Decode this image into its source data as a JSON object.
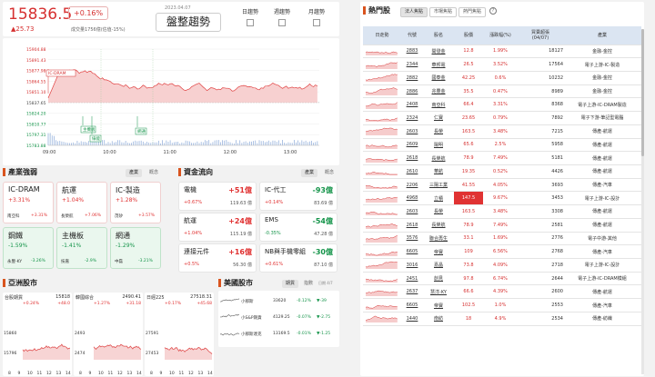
{
  "quote": {
    "price": "15836.5",
    "change_pct": "+0.16%",
    "change": "▲25.73",
    "volume": "成交量1756億(估值-15%)",
    "date": "2023.04.07",
    "trend": "盤整趨勢",
    "checks": [
      "日趨勢",
      "週趨勢",
      "月趨勢"
    ]
  },
  "intraday": {
    "yticks": [
      "15904.88",
      "15891.43",
      "15877.98",
      "15864.55",
      "15851.10",
      "15837.65",
      "15824.20",
      "15810.77",
      "15797.31",
      "15783.88"
    ],
    "xticks": [
      "09:00",
      "10:00",
      "11:00",
      "12:00",
      "13:00"
    ],
    "annotations": [
      "IC-DRAM",
      "主機板",
      "綠能",
      "網通"
    ]
  },
  "industry": {
    "title": "產業強弱",
    "tabs": [
      "產業",
      "概念"
    ],
    "items": [
      {
        "name": "IC-DRAM",
        "pct": "+3.31%",
        "sub": "南亞科",
        "subpct": "+3.31%"
      },
      {
        "name": "航運",
        "pct": "+1.04%",
        "sub": "長榮航",
        "subpct": "+7.06%"
      },
      {
        "name": "IC-製造",
        "pct": "+1.28%",
        "sub": "茂矽",
        "subpct": "+3.57%"
      },
      {
        "name": "鋼鐵",
        "pct": "-1.59%",
        "sub": "永豐-KY",
        "subpct": "-3.26%"
      },
      {
        "name": "主機板",
        "pct": "-1.41%",
        "sub": "技嘉",
        "subpct": "-2.9%"
      },
      {
        "name": "網通",
        "pct": "-1.29%",
        "sub": "中磊",
        "subpct": "-3.21%"
      }
    ]
  },
  "fund": {
    "title": "資金流向",
    "tabs": [
      "產業",
      "概念"
    ],
    "items": [
      {
        "name": "電機",
        "amt": "+51億",
        "pct": "+0.67%",
        "val": "119.63 億"
      },
      {
        "name": "IC-代工",
        "amt": "-93億",
        "pct": "+0.14%",
        "val": "83.69 億"
      },
      {
        "name": "航運",
        "amt": "+24億",
        "pct": "+1.04%",
        "val": "115.19 億"
      },
      {
        "name": "EMS",
        "amt": "-54億",
        "pct": "-0.35%",
        "val": "47.28 億"
      },
      {
        "name": "連接元件",
        "amt": "+16億",
        "pct": "+0.5%",
        "val": "56.30 億"
      },
      {
        "name": "NB與手機零組",
        "amt": "-30億",
        "pct": "+0.61%",
        "val": "87.10 億"
      }
    ]
  },
  "asia": {
    "title": "亞洲股市",
    "markets": [
      {
        "name": "台股期貨",
        "price": "15818",
        "chg": "+0.24%",
        "chg2": "+48.0",
        "low": "15796",
        "high": "15860",
        "xt": [
          "8",
          "9",
          "10",
          "11",
          "12",
          "13",
          "14"
        ]
      },
      {
        "name": "韓國綜合",
        "price": "2490.41",
        "chg": "+1.27%",
        "chg2": "+31.18",
        "low": "2474",
        "high": "2493",
        "xt": [
          "8",
          "9",
          "10",
          "11",
          "12",
          "13",
          "14"
        ]
      },
      {
        "name": "日經225",
        "price": "27518.31",
        "chg": "+0.17%",
        "chg2": "+45.68",
        "low": "27453",
        "high": "27591",
        "xt": [
          "8",
          "9",
          "10",
          "11",
          "12",
          "13",
          "14"
        ]
      }
    ]
  },
  "us": {
    "title": "美國股市",
    "tabs": [
      "期貨",
      "指數"
    ],
    "date": "日期 4/7",
    "items": [
      {
        "name": "小那斯",
        "price": "33620",
        "pct": "-0.12%",
        "chg": "▼-39"
      },
      {
        "name": "小S&P期貨",
        "price": "4129.25",
        "pct": "-0.07%",
        "chg": "▼-2.75"
      },
      {
        "name": "小那斯達克",
        "price": "13169.5",
        "pct": "-0.01%",
        "chg": "▼-1.25"
      }
    ]
  },
  "hot": {
    "title": "熱門股",
    "tabs": [
      "法人焦點",
      "市場焦點",
      "熱門焦點"
    ],
    "headers": [
      "日走勢",
      "代號",
      "股名",
      "股價",
      "漲跌幅(%)",
      "買賣超張\n(04/07)",
      "產業"
    ],
    "rows": [
      [
        "2883",
        "開發金",
        "12.8",
        "1.99%",
        "18127",
        "金融-金控"
      ],
      [
        "2344",
        "華邦電",
        "26.5",
        "3.52%",
        "17564",
        "電子上游-IC-製造"
      ],
      [
        "2882",
        "國泰金",
        "42.25",
        "0.6%",
        "10232",
        "金融-金控"
      ],
      [
        "2886",
        "兆豐金",
        "35.5",
        "0.47%",
        "8989",
        "金融-金控"
      ],
      [
        "2408",
        "南亞科",
        "66.4",
        "3.31%",
        "8368",
        "電子上游-IC-DRAM製造"
      ],
      [
        "2324",
        "仁寶",
        "23.65",
        "0.79%",
        "7892",
        "電子下游-筆記型電腦"
      ],
      [
        "2603",
        "長榮",
        "163.5",
        "3.48%",
        "7215",
        "傳產-航運"
      ],
      [
        "2609",
        "陽明",
        "65.6",
        "2.5%",
        "5958",
        "傳產-航運"
      ],
      [
        "2618",
        "長榮航",
        "78.9",
        "7.49%",
        "5181",
        "傳產-航運"
      ],
      [
        "2610",
        "華航",
        "19.35",
        "0.52%",
        "4426",
        "傳產-航運"
      ],
      [
        "2206",
        "三陽工業",
        "41.55",
        "4.05%",
        "3693",
        "傳產-汽車"
      ],
      [
        "4968",
        "立積",
        "147.5",
        "9.67%",
        "3453",
        "電子上游-IC-設計"
      ],
      [
        "2603",
        "長榮",
        "163.5",
        "3.48%",
        "3308",
        "傳產-航運"
      ],
      [
        "2618",
        "長榮航",
        "78.9",
        "7.49%",
        "2581",
        "傳產-航運"
      ],
      [
        "3576",
        "聯合再生",
        "33.1",
        "1.69%",
        "2776",
        "電子中游-其他"
      ],
      [
        "6605",
        "帝寶",
        "109",
        "6.56%",
        "2768",
        "傳產-汽車"
      ],
      [
        "3016",
        "嘉晶",
        "73.8",
        "4.09%",
        "2718",
        "電子上游-IC-設計"
      ],
      [
        "2451",
        "創見",
        "97.8",
        "6.74%",
        "2644",
        "電子上游-IC-DRAM模組"
      ],
      [
        "2637",
        "慧洋-KY",
        "66.6",
        "4.39%",
        "2600",
        "傳產-航運"
      ],
      [
        "6605",
        "帝寶",
        "102.5",
        "1.0%",
        "2553",
        "傳產-汽車"
      ],
      [
        "1440",
        "南紡",
        "18",
        "4.9%",
        "2534",
        "傳產-紡織"
      ]
    ]
  }
}
